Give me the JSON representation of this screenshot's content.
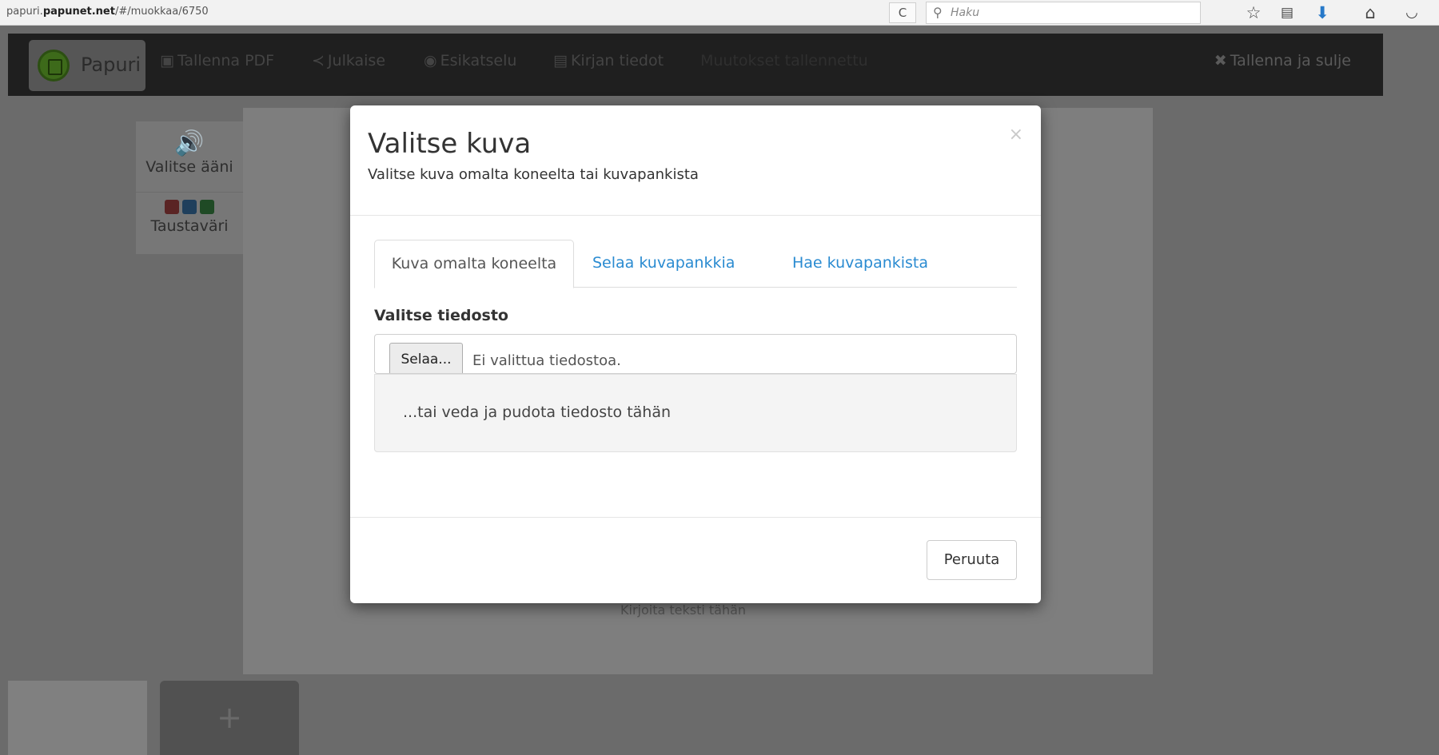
{
  "browser": {
    "url_host": "papuri.papunet.net",
    "url_prefix": "papuri.",
    "url_domain": "papunet.net",
    "url_path": "/#/muokkaa/6750",
    "reload_glyph": "C",
    "search_placeholder": "Haku",
    "icons": [
      "star-icon",
      "reading-list-icon",
      "download-icon",
      "home-icon",
      "pocket-icon"
    ]
  },
  "toolbar": {
    "brand": "Papuri",
    "save_pdf": "Tallenna PDF",
    "publish": "Julkaise",
    "preview": "Esikatselu",
    "book_info": "Kirjan tiedot",
    "saved_status": "Muutokset tallennettu",
    "save_close": "Tallenna ja sulje"
  },
  "side_panel": {
    "audio_label": "Valitse ääni",
    "background_label": "Taustaväri",
    "swatch_colors": [
      "#8b2e2e",
      "#1f5b8a",
      "#2b6e34"
    ]
  },
  "canvas": {
    "placeholder_text": "Kirjoita teksti tähän",
    "add_page": "+"
  },
  "modal": {
    "title": "Valitse kuva",
    "subtitle": "Valitse kuva omalta koneelta tai kuvapankista",
    "close": "×",
    "tabs": [
      {
        "label": "Kuva omalta koneelta",
        "active": true
      },
      {
        "label": "Selaa kuvapankkia",
        "active": false
      },
      {
        "label": "Hae kuvapankista",
        "active": false
      }
    ],
    "file_label": "Valitse tiedosto",
    "browse_button": "Selaa...",
    "file_status": "Ei valittua tiedostoa.",
    "drop_text": "...tai veda ja pudota tiedosto tähän",
    "cancel": "Peruuta"
  },
  "colors": {
    "accent": "#2a8bd1",
    "overlay": "#6b6b6b",
    "toolbar": "#1f1f1f"
  }
}
